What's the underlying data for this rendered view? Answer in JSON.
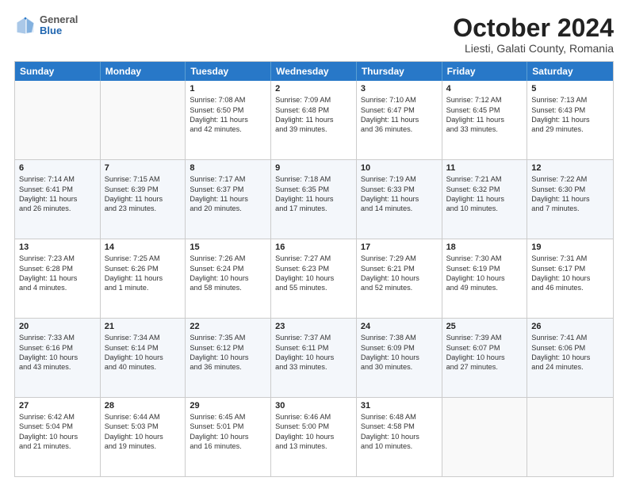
{
  "header": {
    "logo_general": "General",
    "logo_blue": "Blue",
    "month_title": "October 2024",
    "location": "Liesti, Galati County, Romania"
  },
  "weekdays": [
    "Sunday",
    "Monday",
    "Tuesday",
    "Wednesday",
    "Thursday",
    "Friday",
    "Saturday"
  ],
  "rows": [
    [
      {
        "day": "",
        "lines": []
      },
      {
        "day": "",
        "lines": []
      },
      {
        "day": "1",
        "lines": [
          "Sunrise: 7:08 AM",
          "Sunset: 6:50 PM",
          "Daylight: 11 hours",
          "and 42 minutes."
        ]
      },
      {
        "day": "2",
        "lines": [
          "Sunrise: 7:09 AM",
          "Sunset: 6:48 PM",
          "Daylight: 11 hours",
          "and 39 minutes."
        ]
      },
      {
        "day": "3",
        "lines": [
          "Sunrise: 7:10 AM",
          "Sunset: 6:47 PM",
          "Daylight: 11 hours",
          "and 36 minutes."
        ]
      },
      {
        "day": "4",
        "lines": [
          "Sunrise: 7:12 AM",
          "Sunset: 6:45 PM",
          "Daylight: 11 hours",
          "and 33 minutes."
        ]
      },
      {
        "day": "5",
        "lines": [
          "Sunrise: 7:13 AM",
          "Sunset: 6:43 PM",
          "Daylight: 11 hours",
          "and 29 minutes."
        ]
      }
    ],
    [
      {
        "day": "6",
        "lines": [
          "Sunrise: 7:14 AM",
          "Sunset: 6:41 PM",
          "Daylight: 11 hours",
          "and 26 minutes."
        ]
      },
      {
        "day": "7",
        "lines": [
          "Sunrise: 7:15 AM",
          "Sunset: 6:39 PM",
          "Daylight: 11 hours",
          "and 23 minutes."
        ]
      },
      {
        "day": "8",
        "lines": [
          "Sunrise: 7:17 AM",
          "Sunset: 6:37 PM",
          "Daylight: 11 hours",
          "and 20 minutes."
        ]
      },
      {
        "day": "9",
        "lines": [
          "Sunrise: 7:18 AM",
          "Sunset: 6:35 PM",
          "Daylight: 11 hours",
          "and 17 minutes."
        ]
      },
      {
        "day": "10",
        "lines": [
          "Sunrise: 7:19 AM",
          "Sunset: 6:33 PM",
          "Daylight: 11 hours",
          "and 14 minutes."
        ]
      },
      {
        "day": "11",
        "lines": [
          "Sunrise: 7:21 AM",
          "Sunset: 6:32 PM",
          "Daylight: 11 hours",
          "and 10 minutes."
        ]
      },
      {
        "day": "12",
        "lines": [
          "Sunrise: 7:22 AM",
          "Sunset: 6:30 PM",
          "Daylight: 11 hours",
          "and 7 minutes."
        ]
      }
    ],
    [
      {
        "day": "13",
        "lines": [
          "Sunrise: 7:23 AM",
          "Sunset: 6:28 PM",
          "Daylight: 11 hours",
          "and 4 minutes."
        ]
      },
      {
        "day": "14",
        "lines": [
          "Sunrise: 7:25 AM",
          "Sunset: 6:26 PM",
          "Daylight: 11 hours",
          "and 1 minute."
        ]
      },
      {
        "day": "15",
        "lines": [
          "Sunrise: 7:26 AM",
          "Sunset: 6:24 PM",
          "Daylight: 10 hours",
          "and 58 minutes."
        ]
      },
      {
        "day": "16",
        "lines": [
          "Sunrise: 7:27 AM",
          "Sunset: 6:23 PM",
          "Daylight: 10 hours",
          "and 55 minutes."
        ]
      },
      {
        "day": "17",
        "lines": [
          "Sunrise: 7:29 AM",
          "Sunset: 6:21 PM",
          "Daylight: 10 hours",
          "and 52 minutes."
        ]
      },
      {
        "day": "18",
        "lines": [
          "Sunrise: 7:30 AM",
          "Sunset: 6:19 PM",
          "Daylight: 10 hours",
          "and 49 minutes."
        ]
      },
      {
        "day": "19",
        "lines": [
          "Sunrise: 7:31 AM",
          "Sunset: 6:17 PM",
          "Daylight: 10 hours",
          "and 46 minutes."
        ]
      }
    ],
    [
      {
        "day": "20",
        "lines": [
          "Sunrise: 7:33 AM",
          "Sunset: 6:16 PM",
          "Daylight: 10 hours",
          "and 43 minutes."
        ]
      },
      {
        "day": "21",
        "lines": [
          "Sunrise: 7:34 AM",
          "Sunset: 6:14 PM",
          "Daylight: 10 hours",
          "and 40 minutes."
        ]
      },
      {
        "day": "22",
        "lines": [
          "Sunrise: 7:35 AM",
          "Sunset: 6:12 PM",
          "Daylight: 10 hours",
          "and 36 minutes."
        ]
      },
      {
        "day": "23",
        "lines": [
          "Sunrise: 7:37 AM",
          "Sunset: 6:11 PM",
          "Daylight: 10 hours",
          "and 33 minutes."
        ]
      },
      {
        "day": "24",
        "lines": [
          "Sunrise: 7:38 AM",
          "Sunset: 6:09 PM",
          "Daylight: 10 hours",
          "and 30 minutes."
        ]
      },
      {
        "day": "25",
        "lines": [
          "Sunrise: 7:39 AM",
          "Sunset: 6:07 PM",
          "Daylight: 10 hours",
          "and 27 minutes."
        ]
      },
      {
        "day": "26",
        "lines": [
          "Sunrise: 7:41 AM",
          "Sunset: 6:06 PM",
          "Daylight: 10 hours",
          "and 24 minutes."
        ]
      }
    ],
    [
      {
        "day": "27",
        "lines": [
          "Sunrise: 6:42 AM",
          "Sunset: 5:04 PM",
          "Daylight: 10 hours",
          "and 21 minutes."
        ]
      },
      {
        "day": "28",
        "lines": [
          "Sunrise: 6:44 AM",
          "Sunset: 5:03 PM",
          "Daylight: 10 hours",
          "and 19 minutes."
        ]
      },
      {
        "day": "29",
        "lines": [
          "Sunrise: 6:45 AM",
          "Sunset: 5:01 PM",
          "Daylight: 10 hours",
          "and 16 minutes."
        ]
      },
      {
        "day": "30",
        "lines": [
          "Sunrise: 6:46 AM",
          "Sunset: 5:00 PM",
          "Daylight: 10 hours",
          "and 13 minutes."
        ]
      },
      {
        "day": "31",
        "lines": [
          "Sunrise: 6:48 AM",
          "Sunset: 4:58 PM",
          "Daylight: 10 hours",
          "and 10 minutes."
        ]
      },
      {
        "day": "",
        "lines": []
      },
      {
        "day": "",
        "lines": []
      }
    ]
  ]
}
